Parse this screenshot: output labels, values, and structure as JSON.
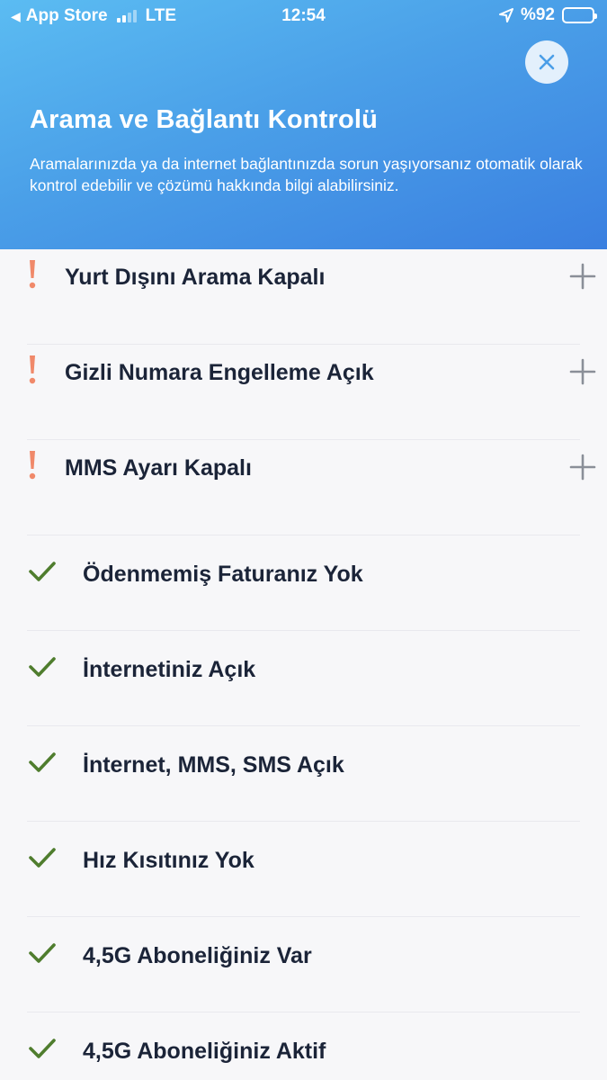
{
  "status_bar": {
    "back_label": "App Store",
    "network": "LTE",
    "time": "12:54",
    "battery": "%92"
  },
  "header": {
    "title": "Arama ve Bağlantı Kontrolü",
    "subtitle": "Aramalarınızda ya da internet bağlantınızda sorun yaşıyorsanız otomatik olarak kontrol edebilir ve çözümü hakkında bilgi alabilirsiniz."
  },
  "colors": {
    "warning": "#f0896a",
    "check": "#4f7d2e",
    "plus": "#8a8f98",
    "text": "#1b2438"
  },
  "checks": [
    {
      "label": "Yurt Dışını Arama Kapalı",
      "status": "warning",
      "icon": "exclamation-icon",
      "action_icon": "plus-icon"
    },
    {
      "label": "Gizli Numara Engelleme Açık",
      "status": "warning",
      "icon": "exclamation-icon",
      "action_icon": "plus-icon"
    },
    {
      "label": "MMS Ayarı Kapalı",
      "status": "warning",
      "icon": "exclamation-icon",
      "action_icon": "plus-icon"
    },
    {
      "label": "Ödenmemiş Faturanız Yok",
      "status": "ok",
      "icon": "checkmark-icon"
    },
    {
      "label": "İnternetiniz Açık",
      "status": "ok",
      "icon": "checkmark-icon"
    },
    {
      "label": "İnternet, MMS, SMS Açık",
      "status": "ok",
      "icon": "checkmark-icon"
    },
    {
      "label": "Hız Kısıtınız Yok",
      "status": "ok",
      "icon": "checkmark-icon"
    },
    {
      "label": "4,5G Aboneliğiniz Var",
      "status": "ok",
      "icon": "checkmark-icon"
    },
    {
      "label": "4,5G Aboneliğiniz Aktif",
      "status": "ok",
      "icon": "checkmark-icon"
    }
  ]
}
